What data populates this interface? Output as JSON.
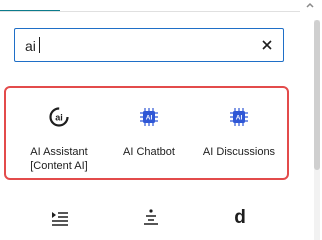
{
  "search": {
    "value": "ai",
    "clear_icon": "close-icon"
  },
  "results": [
    {
      "label": "AI Assistant\n[Content AI]",
      "icon": "ai-assistant-icon"
    },
    {
      "label": "AI Chatbot",
      "icon": "ai-chip-icon"
    },
    {
      "label": "AI Discussions",
      "icon": "ai-chip-icon"
    }
  ],
  "bottom_row": {
    "icons": [
      "list-indent-icon",
      "align-center-icon"
    ],
    "letter": "d"
  },
  "colors": {
    "highlight_border": "#e34b4b",
    "focus_border": "#1f6fc7",
    "ai_chip": "#2f57d6",
    "tab_active": "#0c7c8c"
  }
}
